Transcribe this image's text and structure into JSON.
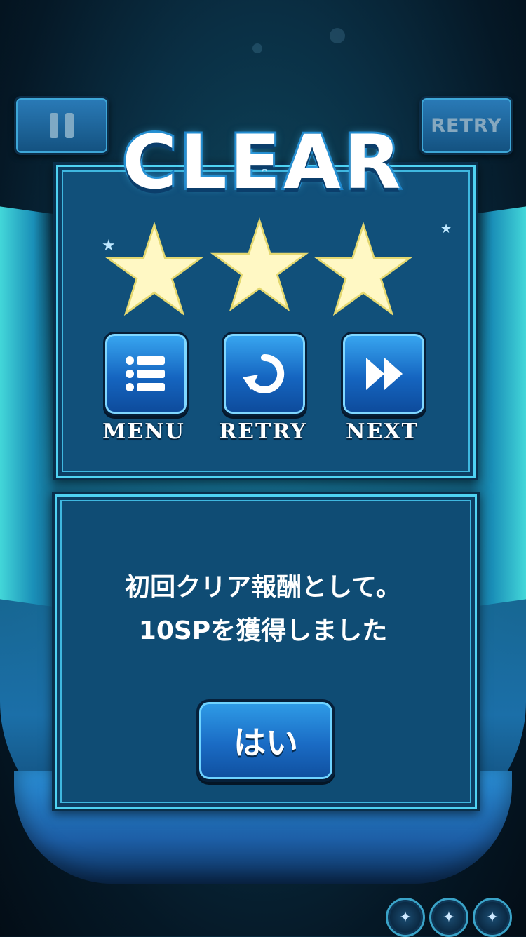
{
  "header": {
    "pause_icon": "pause-icon",
    "retry_label": "RETRY"
  },
  "result": {
    "title": "CLEAR",
    "stars_earned": 3,
    "stars_total": 3,
    "buttons": [
      {
        "label": "MENU",
        "icon": "list-icon"
      },
      {
        "label": "RETRY",
        "icon": "retry-arrow-icon"
      },
      {
        "label": "NEXT",
        "icon": "fast-forward-icon"
      }
    ]
  },
  "reward": {
    "line1": "初回クリア報酬として。",
    "line2": "10SPを獲得しました",
    "confirm_label": "はい"
  },
  "colors": {
    "panel": "#11507a",
    "panel_border": "#4fd2f2",
    "star": "#fff8c4",
    "button": "#1565c0"
  }
}
